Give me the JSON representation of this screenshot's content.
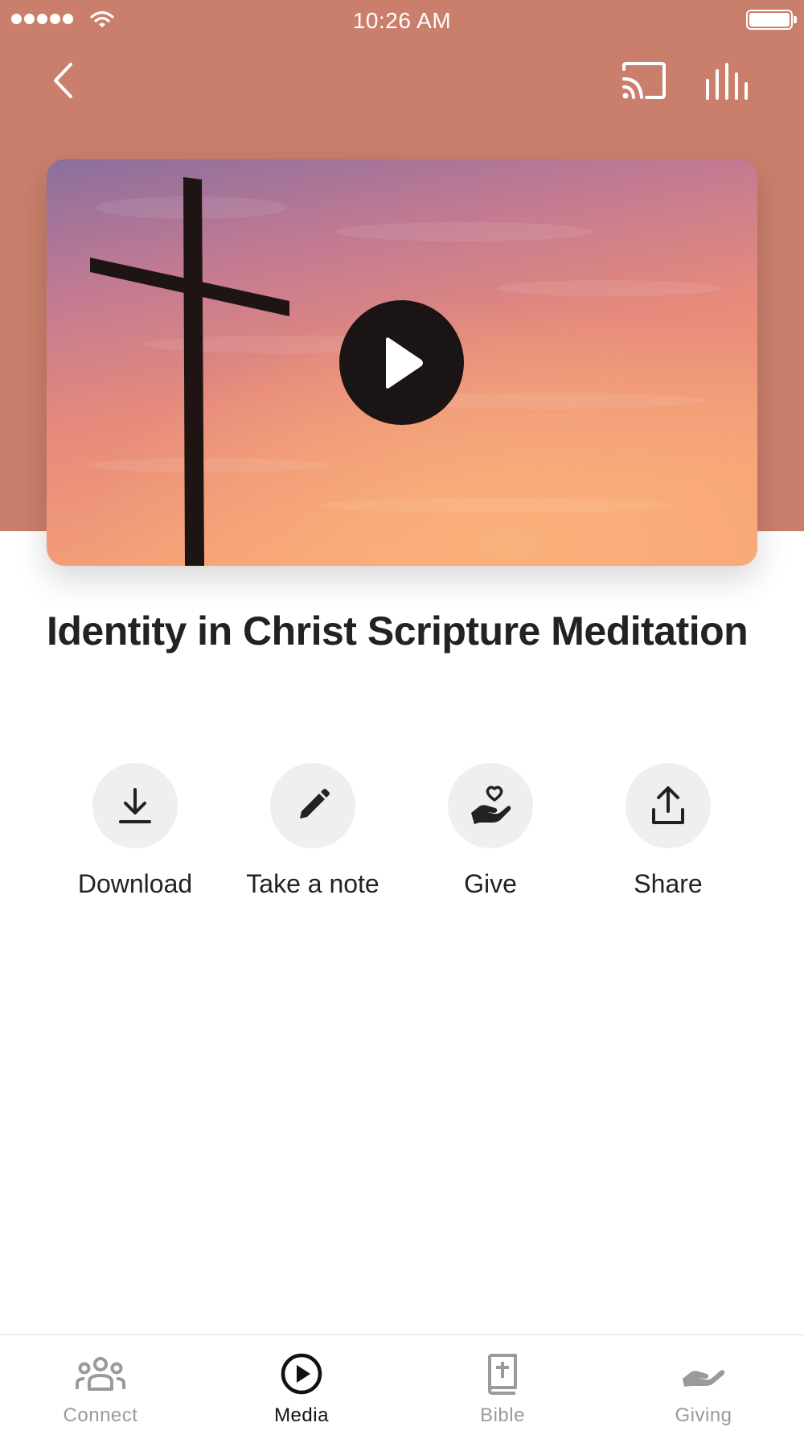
{
  "status_bar": {
    "time": "10:26 AM"
  },
  "header": {
    "back_icon": "chevron-left-icon",
    "cast_icon": "cast-icon",
    "audio_icon": "equalizer-bars-icon"
  },
  "media": {
    "artwork": "cross-at-sunset",
    "play_icon": "play-icon",
    "title": "Identity in Christ Scripture Meditation"
  },
  "actions": [
    {
      "label": "Download",
      "icon": "download-icon"
    },
    {
      "label": "Take a note",
      "icon": "pencil-icon"
    },
    {
      "label": "Give",
      "icon": "hand-heart-icon"
    },
    {
      "label": "Share",
      "icon": "share-icon"
    }
  ],
  "tabs": [
    {
      "label": "Connect",
      "icon": "people-icon",
      "active": false
    },
    {
      "label": "Media",
      "icon": "play-circle-icon",
      "active": true
    },
    {
      "label": "Bible",
      "icon": "bible-icon",
      "active": false
    },
    {
      "label": "Giving",
      "icon": "giving-hand-icon",
      "active": false
    }
  ],
  "colors": {
    "header_bg": "#c97f6b",
    "play_button": "#1b1414",
    "action_circle": "#efefef",
    "tab_active": "#111111",
    "tab_inactive": "#9a9a9a"
  }
}
